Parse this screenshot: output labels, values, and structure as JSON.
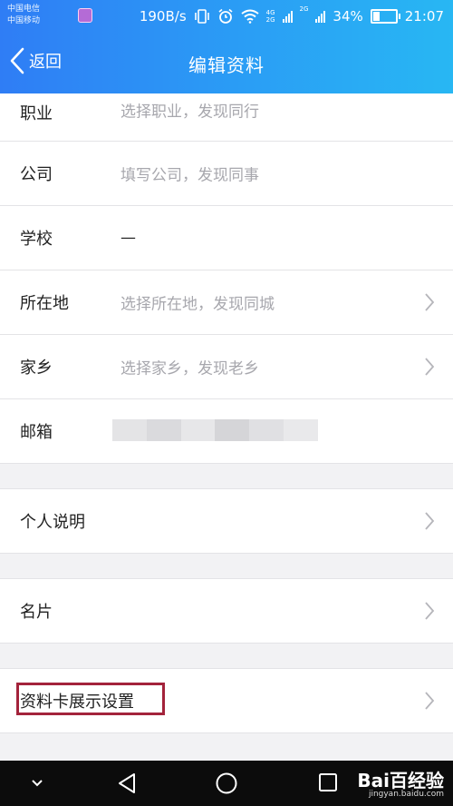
{
  "status_bar": {
    "carrier_1": "中国电信",
    "carrier_2": "中国移动",
    "speed": "190B/s",
    "battery": "34%",
    "battery_level": 0.34,
    "time": "21:07",
    "net_4g": "4G",
    "net_2g": "2G"
  },
  "header": {
    "back_label": "返回",
    "title": "编辑资料"
  },
  "fields": [
    {
      "label": "职业",
      "value": "选择职业，发现同行",
      "placeholder": true,
      "chevron": false
    },
    {
      "label": "公司",
      "value": "填写公司，发现同事",
      "placeholder": true,
      "chevron": false
    },
    {
      "label": "学校",
      "value": "—",
      "placeholder": false,
      "chevron": false
    },
    {
      "label": "所在地",
      "value": "选择所在地，发现同城",
      "placeholder": true,
      "chevron": true
    },
    {
      "label": "家乡",
      "value": "选择家乡，发现老乡",
      "placeholder": true,
      "chevron": true
    },
    {
      "label": "邮箱",
      "value": "",
      "placeholder": false,
      "chevron": false,
      "masked": true
    }
  ],
  "sections": [
    {
      "label": "个人说明"
    },
    {
      "label": "名片"
    },
    {
      "label": "资料卡展示设置"
    }
  ],
  "watermark": {
    "brand": "Bai百经验",
    "url": "jingyan.baidu.com"
  },
  "colors": {
    "header_start": "#2f7df5",
    "header_end": "#28b7f3",
    "highlight_border": "#a3233b",
    "placeholder_text": "#a7a7ad"
  }
}
